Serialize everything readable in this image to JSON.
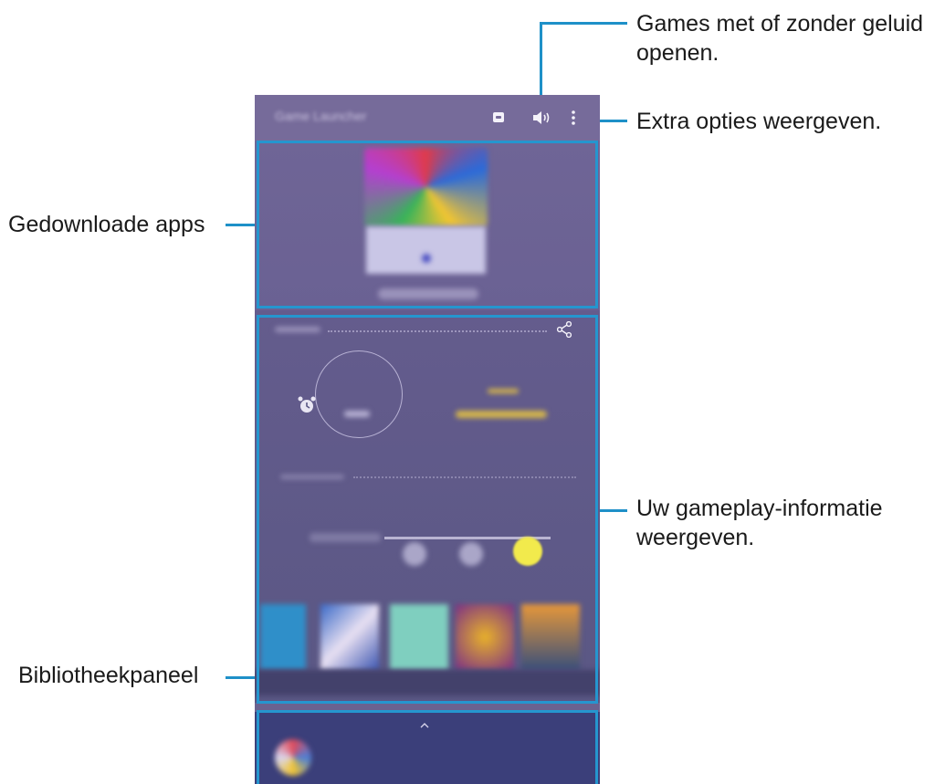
{
  "callouts": {
    "sound": {
      "line1": "Games met of zonder geluid",
      "line2": "openen."
    },
    "options": "Extra opties weergeven.",
    "downloaded": "Gedownloade apps",
    "gameplay": {
      "line1": "Uw gameplay-informatie",
      "line2": "weergeven."
    },
    "library": "Bibliotheekpaneel"
  },
  "appbar": {
    "title": "Game Launcher",
    "icons": [
      "discord-icon",
      "speaker-icon",
      "more-vert-icon"
    ]
  },
  "colors": {
    "accent": "#2596cf",
    "panel_top": "#766b9a",
    "panel_mid": "#5e5a86",
    "library": "#3b3f7a"
  }
}
